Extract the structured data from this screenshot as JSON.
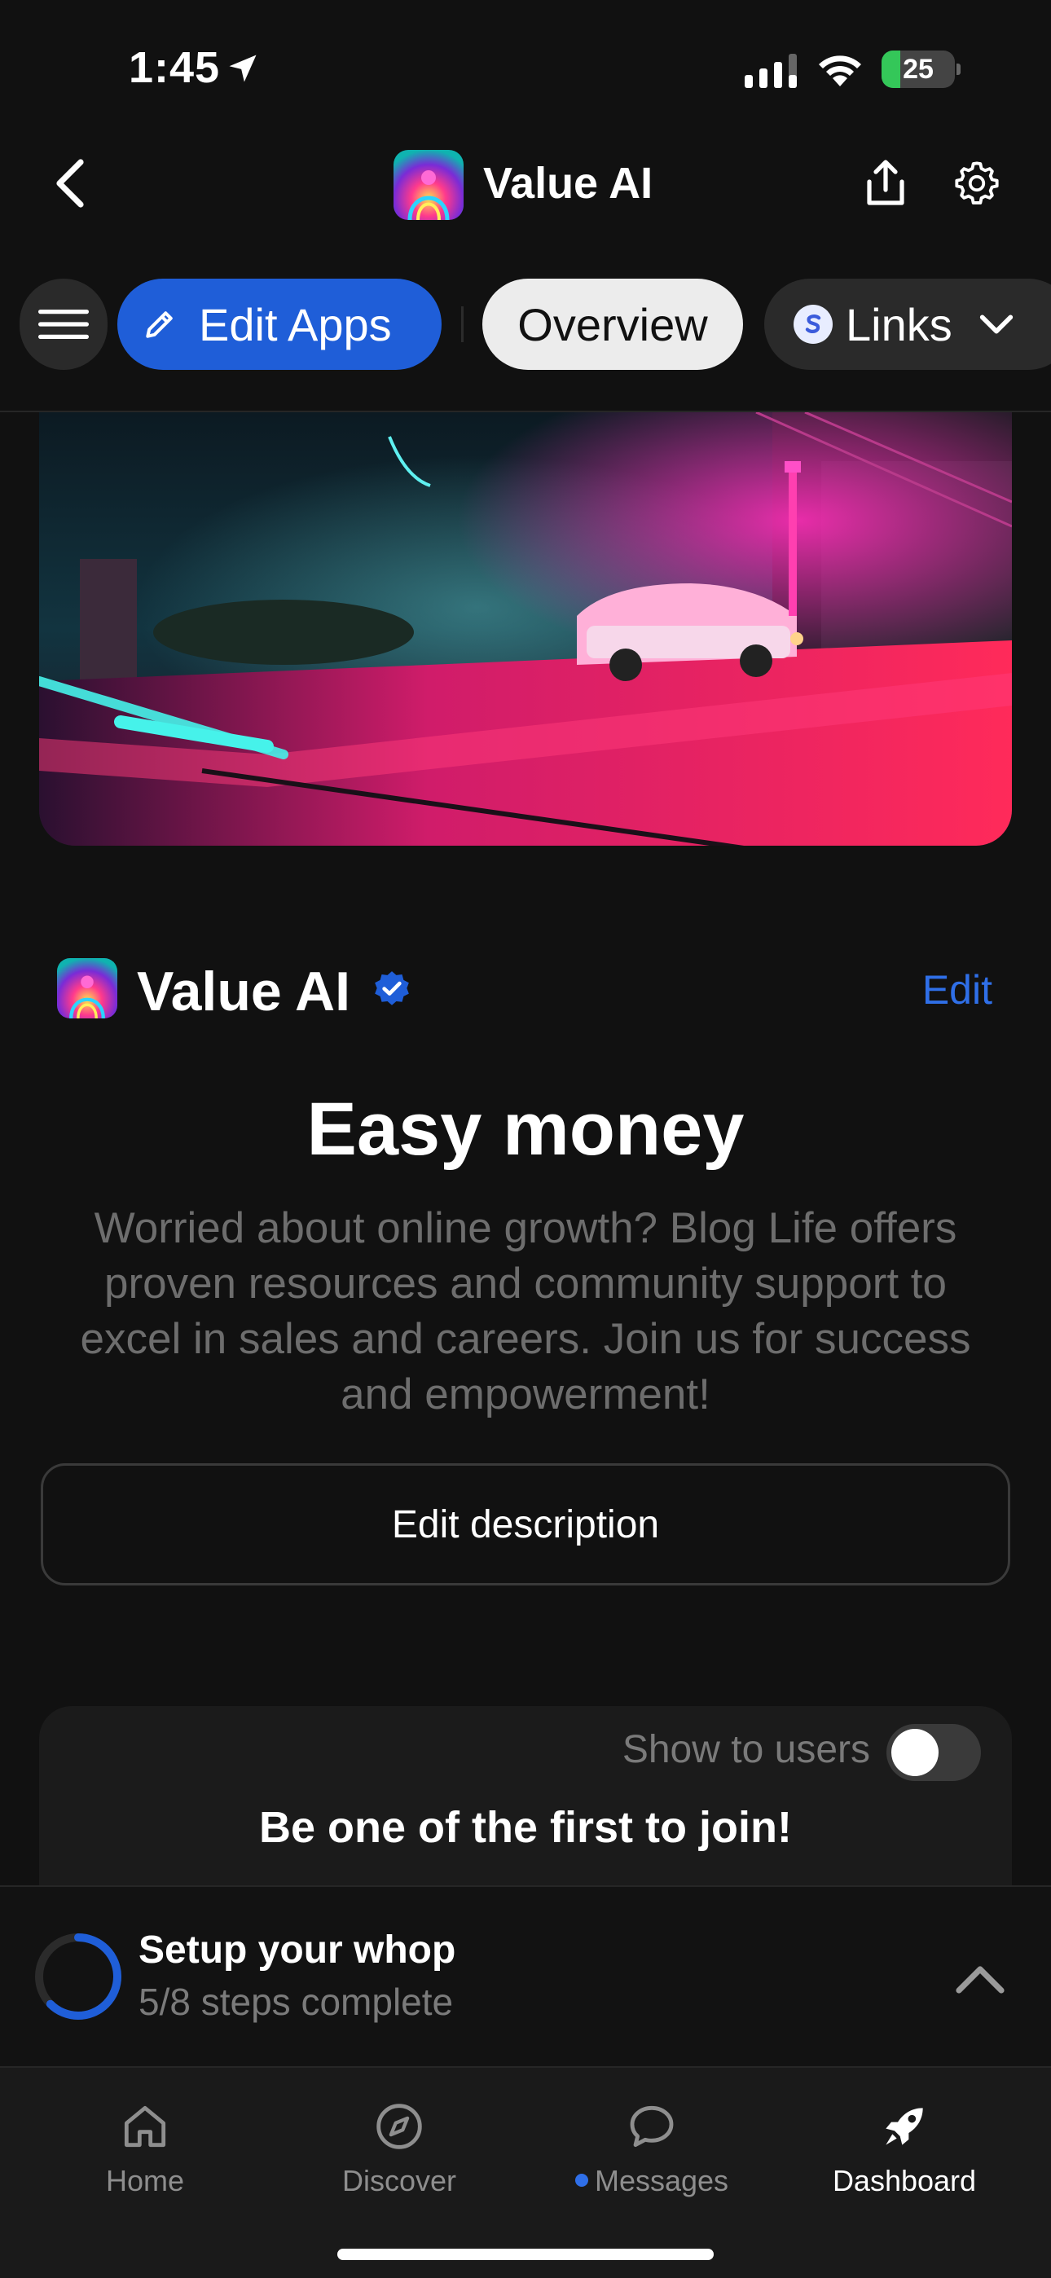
{
  "status_bar": {
    "time": "1:45",
    "battery": "25",
    "battery_level": 0.25,
    "icons": [
      "location-arrow-icon",
      "cellular-signal-icon",
      "wifi-icon",
      "battery-charging-icon"
    ]
  },
  "header": {
    "title": "Value AI",
    "icons": [
      "back-chevron-icon",
      "app-logo",
      "share-icon",
      "gear-icon"
    ]
  },
  "chips": {
    "edit_apps": "Edit Apps",
    "overview": "Overview",
    "links": "Links",
    "icons": [
      "hamburger-menu-icon",
      "pencil-icon",
      "links-s-icon",
      "chevron-down-icon"
    ]
  },
  "creator": {
    "name": "Value AI",
    "edit": "Edit",
    "verified_icon": "verified-badge-icon"
  },
  "content": {
    "headline": "Easy money",
    "description": "Worried about online growth? Blog Life offers proven resources and community support to excel in sales and careers. Join us for success and empowerment!",
    "edit_description": "Edit description"
  },
  "join_card": {
    "show_to_users": "Show to users",
    "toggle_on": false,
    "title": "Be one of the first to join!"
  },
  "setup": {
    "title": "Setup your whop",
    "subtitle": "5/8 steps complete",
    "progress": 0.625
  },
  "tabs": {
    "home": "Home",
    "discover": "Discover",
    "messages": "Messages",
    "dashboard": "Dashboard",
    "active": "dashboard",
    "icons": [
      "home-icon",
      "compass-icon",
      "chat-bubble-icon",
      "rocket-icon"
    ]
  },
  "colors": {
    "background": "#111111",
    "accent": "#1f5ed8",
    "link": "#2f6fe8",
    "muted_text": "#6d6d6d"
  }
}
